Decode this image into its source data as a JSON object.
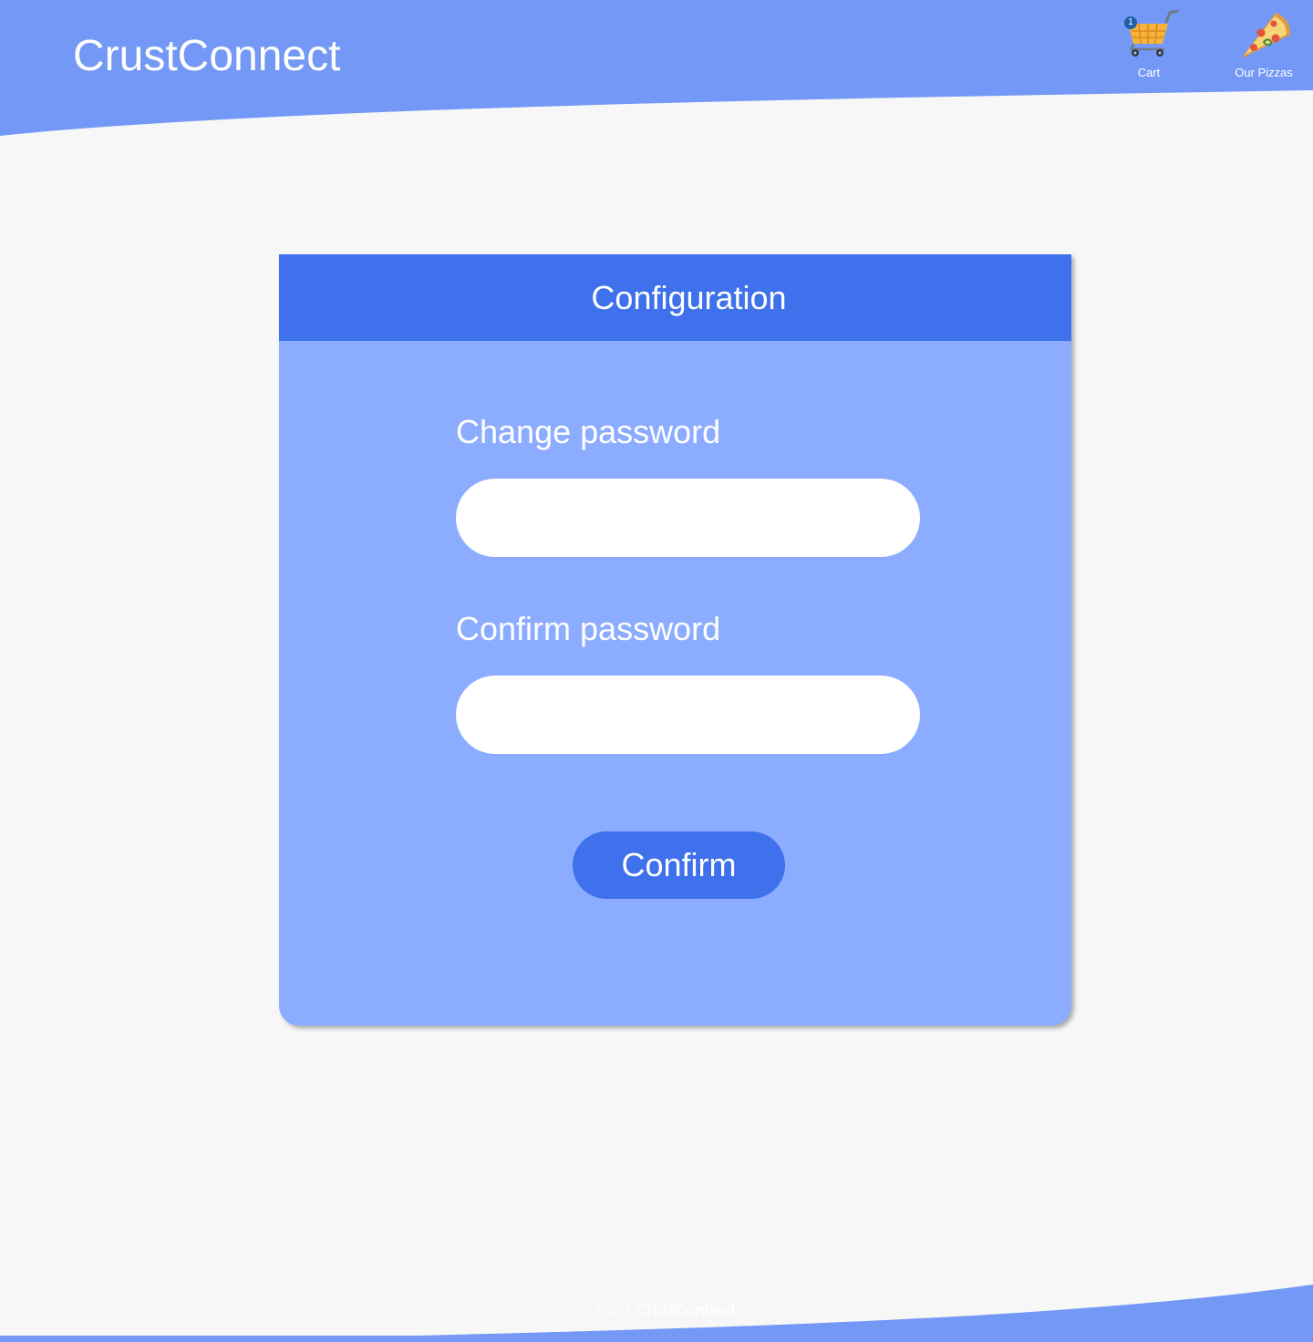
{
  "header": {
    "brand": "CrustConnect",
    "nav": {
      "cart_label": "Cart",
      "cart_count": "1",
      "pizzas_label": "Our Pizzas"
    }
  },
  "card": {
    "title": "Configuration",
    "change_password_label": "Change password",
    "change_password_value": "",
    "confirm_password_label": "Confirm password",
    "confirm_password_value": "",
    "confirm_button": "Confirm"
  },
  "footer": {
    "copyright": "© 2022",
    "brand": "CrustConnect"
  },
  "colors": {
    "header_bg": "#7398f5",
    "card_header": "#3f71ec",
    "card_body": "#8cacff",
    "page_bg": "#f7f7f7"
  },
  "icons": [
    "shopping-cart-icon",
    "pizza-slice-icon"
  ]
}
